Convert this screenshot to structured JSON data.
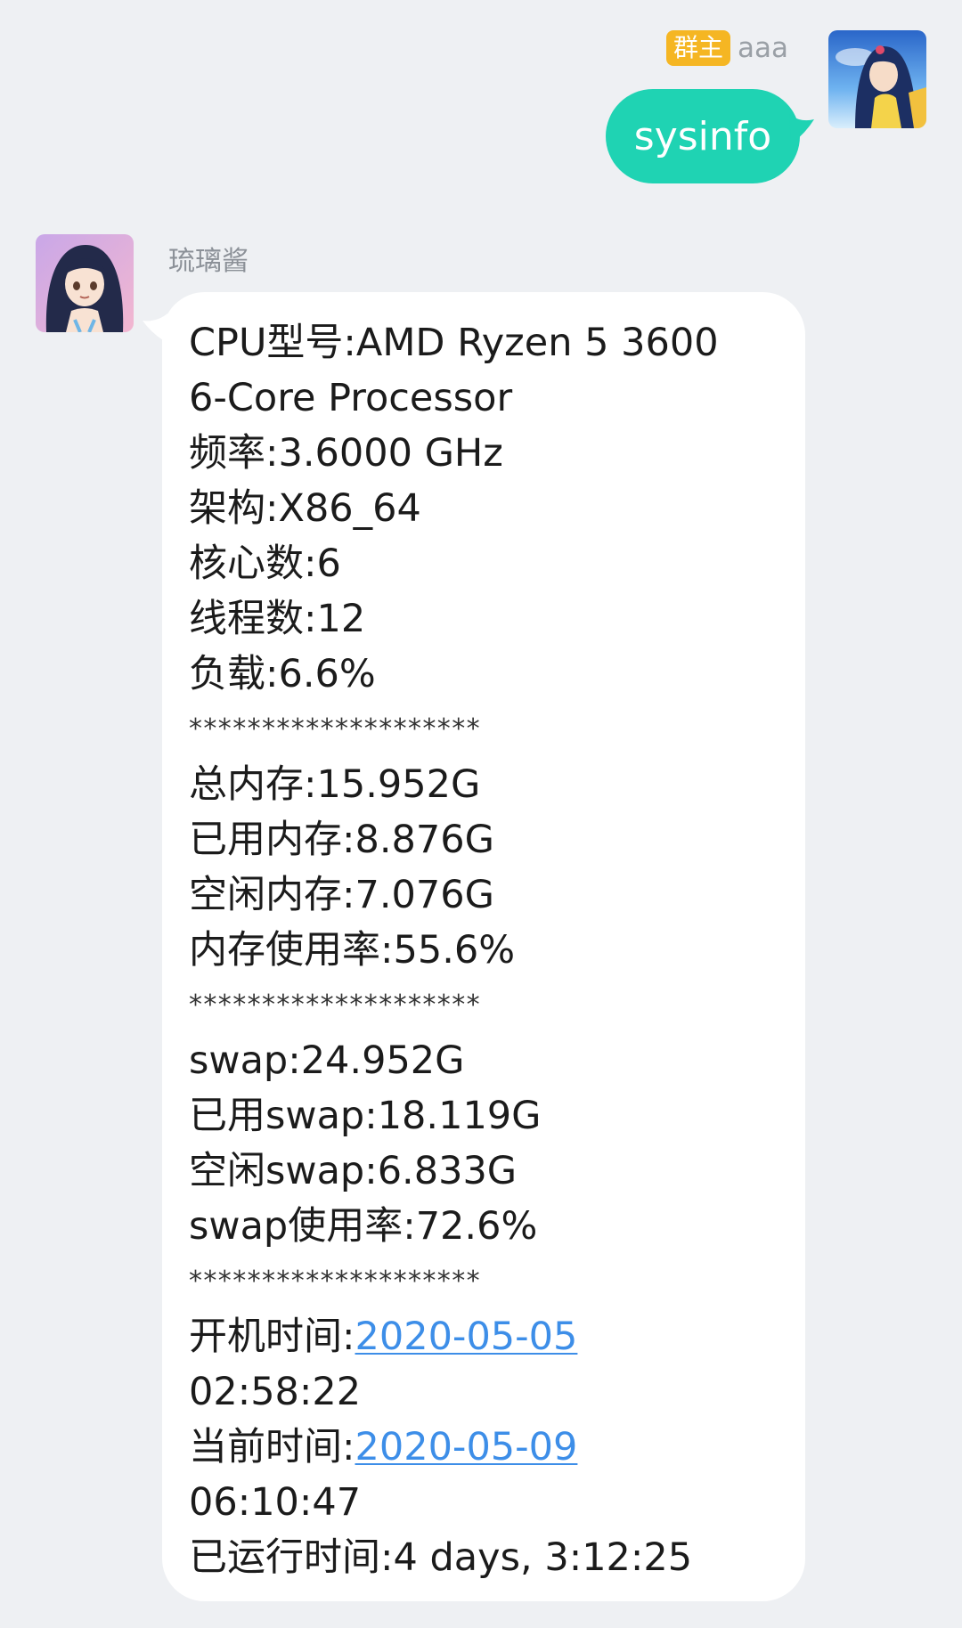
{
  "outgoing": {
    "badge": "群主",
    "sender": "aaa",
    "text": "sysinfo"
  },
  "incoming": {
    "sender": "琉璃酱",
    "lines": [
      "CPU型号:AMD Ryzen 5 3600",
      "6-Core Processor",
      "频率:3.6000 GHz",
      "架构:X86_64",
      "核心数:6",
      "线程数:12",
      "负载:6.6%",
      "********************",
      "总内存:15.952G",
      "已用内存:8.876G",
      "空闲内存:7.076G",
      "内存使用率:55.6%",
      "********************",
      "swap:24.952G",
      "已用swap:18.119G",
      "空闲swap:6.833G",
      "swap使用率:72.6%",
      "********************"
    ],
    "boot_label": "开机时间:",
    "boot_date": "2020-05-05",
    "boot_time": "02:58:22",
    "now_label": "当前时间:",
    "now_date": "2020-05-09",
    "now_time": "06:10:47",
    "uptime": "已运行时间:4 days, 3:12:25"
  },
  "colors": {
    "accent_bubble": "#1fd3b3",
    "badge": "#f5b623",
    "link": "#3d8ee8"
  }
}
